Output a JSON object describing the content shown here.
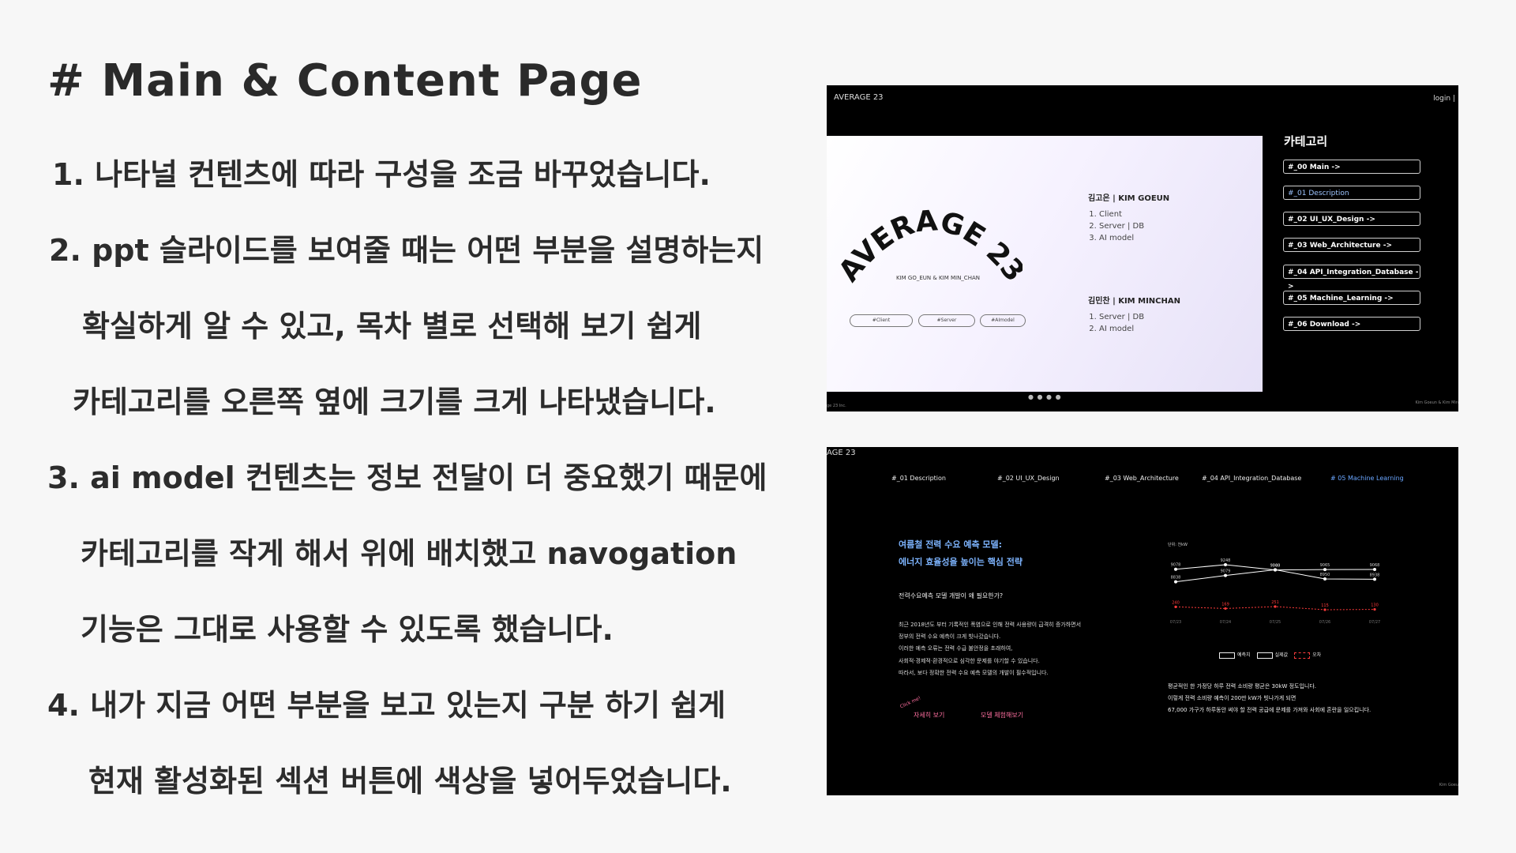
{
  "title": "# Main & Content Page",
  "notes": [
    "1.    나타널 컨텐츠에 따라 구성을 조금 바꾸었습니다.",
    "2.  ppt 슬라이드를 보여줄 때는 어떤 부분을 설명하는지",
    "확실하게 알 수 있고, 목차 별로 선택해 보기 쉽게",
    "카테고리를 오른쪽 옆에 크기를 크게 나타냈습니다.",
    "3. ai model 컨텐츠는 정보 전달이 더 중요했기 때문에",
    "카테고리를 작게 해서 위에 배치했고 navogation",
    "기능은 그대로 사용할 수 있도록 했습니다.",
    "4. 내가 지금 어떤 부분을 보고 있는지 구분 하기 쉽게",
    "현재 활성화된 섹션 버튼에 색상을 넣어두었습니다."
  ],
  "shot1": {
    "brand": "AVERAGE 23",
    "login": "login |",
    "hero_title": "AVERAGE 23",
    "hero_sub": "KIM GO_EUN & KIM MIN_CHAN",
    "tags": [
      "#Client",
      "#Server",
      "#AImodel"
    ],
    "member1_name": "김고은 | KIM GOEUN",
    "member1_roles": [
      "Client",
      "Server | DB",
      "AI model"
    ],
    "member2_name": "김민찬 | KIM MINCHAN",
    "member2_roles": [
      "Server | DB",
      "AI model"
    ],
    "dots": "● ● ● ●",
    "footer_left": "ge 23 Inc.",
    "footer_right": "Kim Goeun & Kim Min",
    "category_title": "카테고리",
    "categories": [
      "#_00 Main ->",
      "#_01 Description",
      "#_02 UI_UX_Design ->",
      "#_03 Web_Architecture ->",
      "#_04 API_Integration_Database ->",
      "#_05 Machine_Learning ->",
      "#_06 Download ->"
    ],
    "active_category_index": 1
  },
  "shot2": {
    "brand": "AGE 23",
    "nav": [
      "#_01 Description",
      "#_02 UI_UX_Design",
      "#_03 Web_Architecture",
      "#_04 API_Integration_Database",
      "# 05 Machine Learning"
    ],
    "active_nav_index": 4,
    "headline1": "여름철 전력 수요 예측 모델:",
    "headline2": "에너지 효율성을 높이는 핵심 전략",
    "question": "전력수요예측 모델 개발이 왜 필요한가?",
    "paragraph": [
      "최근 2018년도 부터 기록적인 폭염으로 인해 전력 사용량이 급격히 증가하면서",
      "정부의 전력 수요 예측이 크게 빗나갔습니다.",
      "이러한 예측 오류는 전력 수급 불안정을 초래하여,",
      "사회적·경제적·환경적으로 심각한 문제를 야기할 수 있습니다.",
      "따라서, 보다 정확한 전력 수요 예측 모델의 개발이 필수적입니다."
    ],
    "click_me": "Click me!",
    "link1": "자세히 보기",
    "link2": "모델 체험해보기",
    "chart_unit": "단위: 천kW",
    "right_paragraph": [
      "평균적인 한 가정당 하루 전력 소비량 평균은 30kW 정도입니다.",
      "이렇게 전력 소비량 예측이 200만 kW가 빗나가게 되면",
      "67,000 가구가 하루동안 써야 할 전력 공급에 문제를 가져와 사회에 혼란을 일으킵니다."
    ],
    "footer": "Kim Goeu"
  },
  "chart_data": {
    "type": "line",
    "categories": [
      "07/23",
      "07/24",
      "07/25",
      "07/26",
      "07/27"
    ],
    "series": [
      {
        "name": "예측치",
        "values": [
          9078,
          9248,
          9049,
          9065,
          9068
        ],
        "color": "#ffffff"
      },
      {
        "name": "실제값",
        "values": [
          8838,
          9079,
          9300,
          8950,
          8938
        ],
        "color": "#ffffff"
      },
      {
        "name": "오차",
        "values": [
          240,
          169,
          251,
          115,
          130
        ],
        "color": "#ff3b3b"
      }
    ],
    "value_labels": {
      "예측치": [
        "9078",
        "9248",
        "9049",
        "9065",
        "9068"
      ],
      "실제값": [
        "8838",
        "9079",
        "9300",
        "8950",
        "8938"
      ],
      "오차": [
        "240",
        "169",
        "251",
        "115",
        "130"
      ]
    },
    "legend": [
      "예측치",
      "실제값",
      "오차"
    ],
    "legend_position": "bottom"
  }
}
